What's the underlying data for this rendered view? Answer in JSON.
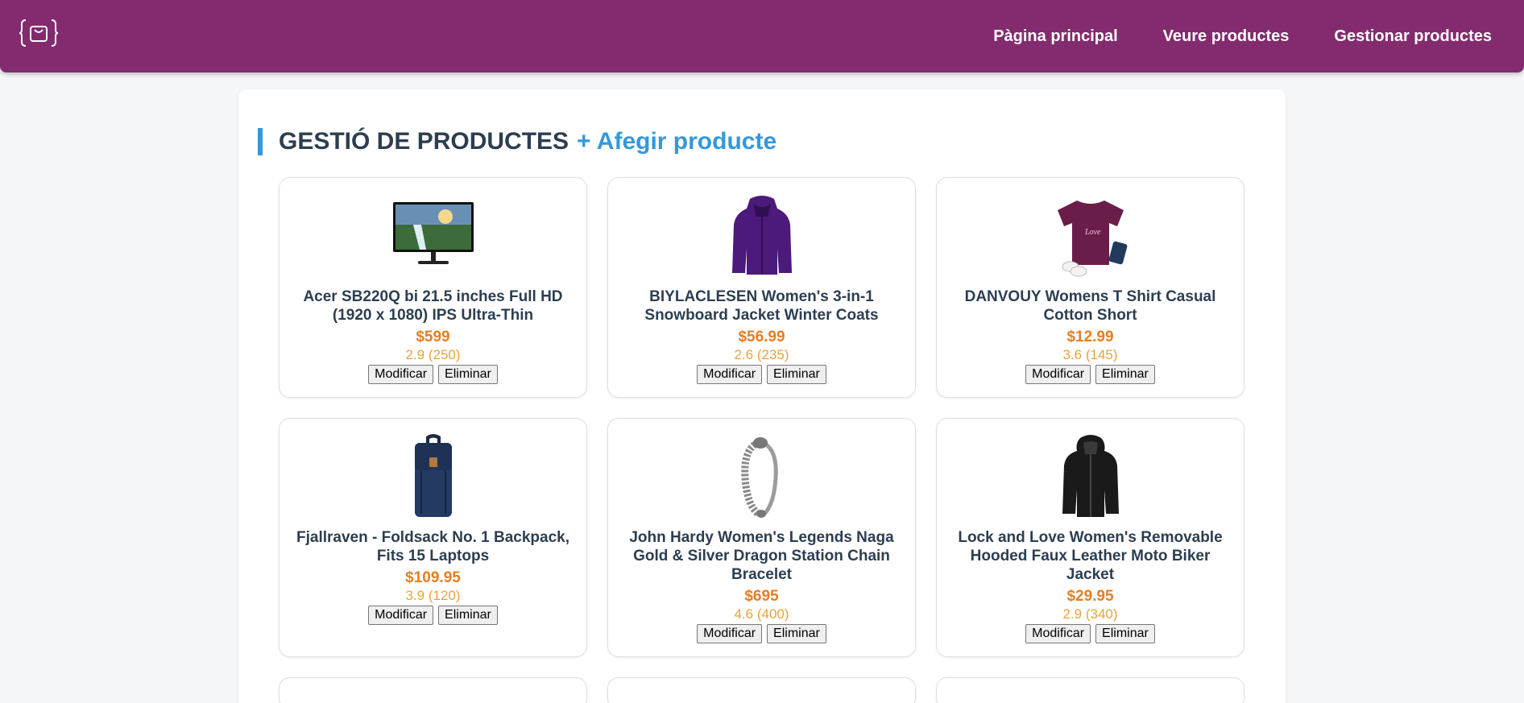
{
  "nav": {
    "links": [
      "Pàgina principal",
      "Veure productes",
      "Gestionar productes"
    ]
  },
  "main": {
    "title": "GESTIÓ DE PRODUCTES",
    "add_label": "+ Afegir producte"
  },
  "buttons": {
    "modify": "Modificar",
    "delete": "Eliminar"
  },
  "products": [
    {
      "title": "Acer SB220Q bi 21.5 inches Full HD (1920 x 1080) IPS Ultra-Thin",
      "price": "$599",
      "rating": "2.9 (250)",
      "image": "monitor"
    },
    {
      "title": "BIYLACLESEN Women's 3-in-1 Snowboard Jacket Winter Coats",
      "price": "$56.99",
      "rating": "2.6 (235)",
      "image": "purple-jacket"
    },
    {
      "title": "DANVOUY Womens T Shirt Casual Cotton Short",
      "price": "$12.99",
      "rating": "3.6 (145)",
      "image": "tshirt"
    },
    {
      "title": "Fjallraven - Foldsack No. 1 Backpack, Fits 15 Laptops",
      "price": "$109.95",
      "rating": "3.9 (120)",
      "image": "backpack"
    },
    {
      "title": "John Hardy Women's Legends Naga Gold & Silver Dragon Station Chain Bracelet",
      "price": "$695",
      "rating": "4.6 (400)",
      "image": "bracelet"
    },
    {
      "title": "Lock and Love Women's Removable Hooded Faux Leather Moto Biker Jacket",
      "price": "$29.95",
      "rating": "2.9 (340)",
      "image": "leather-jacket"
    }
  ],
  "colors": {
    "navbar": "#832b6e",
    "accent": "#3498db",
    "price": "#e67e22",
    "rating": "#e8a33a"
  }
}
